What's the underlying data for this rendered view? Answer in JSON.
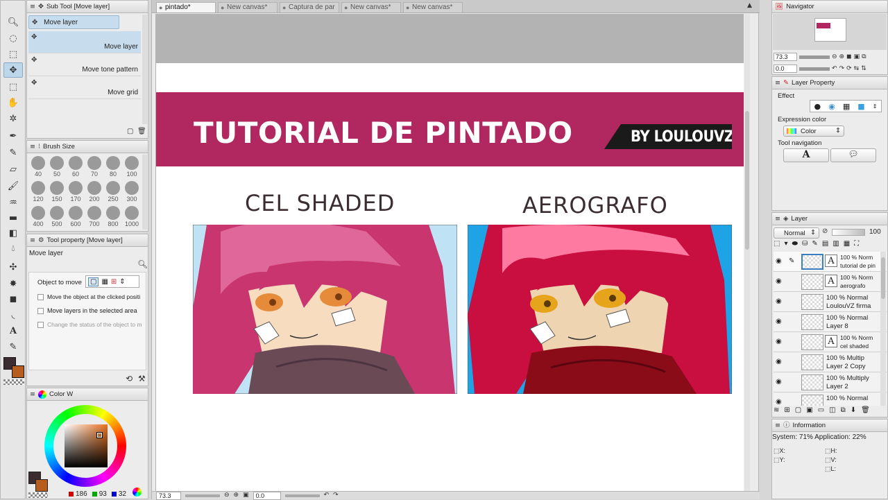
{
  "subtool": {
    "title": "Sub Tool [Move layer]",
    "active_label": "Move layer",
    "items": [
      "Move layer",
      "Move tone pattern",
      "Move grid"
    ]
  },
  "brush_size": {
    "title": "Brush Size",
    "sizes": [
      "40",
      "50",
      "60",
      "70",
      "80",
      "100",
      "120",
      "150",
      "170",
      "200",
      "250",
      "300",
      "400",
      "500",
      "600",
      "700",
      "800",
      "1000"
    ]
  },
  "tool_property": {
    "title": "Tool property [Move layer]",
    "tool_name": "Move layer",
    "object_to_move_label": "Object to move",
    "options": [
      "Move the object at the clicked positi",
      "Move layers in the selected area",
      "Change the status of the object to m"
    ]
  },
  "color_wheel": {
    "title": "Color W",
    "r": "186",
    "g": "93",
    "b": "32",
    "main_color": "#3a2c2f",
    "sub_color": "#b75d20"
  },
  "tabs": [
    {
      "label": "pintado*",
      "active": true
    },
    {
      "label": "New canvas*",
      "active": false
    },
    {
      "label": "Captura de par",
      "active": false
    },
    {
      "label": "New canvas*",
      "active": false
    },
    {
      "label": "New canvas*",
      "active": false
    }
  ],
  "canvas": {
    "banner_title": "TUTORIAL DE PINTADO",
    "banner_credit": "BY LOULOUVZ",
    "banner_color": "#b0285f",
    "left_heading": "CEL SHADED",
    "right_heading": "AEROGRAFO",
    "zoom": "73.3",
    "angle": "0.0"
  },
  "navigator": {
    "title": "Navigator",
    "zoom": "73.3",
    "angle": "0.0"
  },
  "layer_property": {
    "title": "Layer Property",
    "effect_label": "Effect",
    "expression_color_label": "Expression color",
    "expression_color_value": "Color",
    "tool_navigation_label": "Tool navigation",
    "nav_glyph": "A"
  },
  "layer_panel": {
    "title": "Layer",
    "blend_mode": "Normal",
    "opacity": "100",
    "layers": [
      {
        "mode": "100 % Norm",
        "name": "tutorial de pin",
        "text_layer": true,
        "selected": true
      },
      {
        "mode": "100 % Norm",
        "name": "aerografo",
        "text_layer": true,
        "selected": false
      },
      {
        "mode": "100 % Normal",
        "name": "LoulouVZ firma",
        "text_layer": false,
        "selected": false
      },
      {
        "mode": "100 % Normal",
        "name": "Layer 8",
        "text_layer": false,
        "selected": false
      },
      {
        "mode": "100 % Norm",
        "name": "cel shaded",
        "text_layer": true,
        "selected": false
      },
      {
        "mode": "100 % Multip",
        "name": "Layer 2 Copy",
        "text_layer": false,
        "selected": false
      },
      {
        "mode": "100 % Multiply",
        "name": "Layer 2",
        "text_layer": false,
        "selected": false
      },
      {
        "mode": "100 % Normal",
        "name": "",
        "text_layer": false,
        "selected": false
      }
    ]
  },
  "information": {
    "title": "Information",
    "system_line": "System: 71% Application: 22%",
    "x_label": "X:",
    "y_label": "Y:",
    "h_label": "H:",
    "v_label": "V:",
    "l_label": "L:"
  }
}
